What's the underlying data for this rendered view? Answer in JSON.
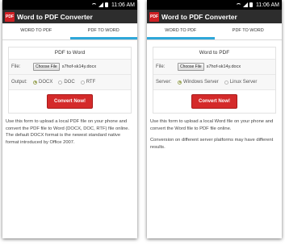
{
  "status": {
    "time": "11:06 AM"
  },
  "app": {
    "title": "Word to PDF Converter",
    "icon_text": "PDF"
  },
  "tabs": [
    "WORD TO PDF",
    "PDF TO WORD"
  ],
  "left": {
    "active_tab": 1,
    "card_title": "PDF to Word",
    "file_label": "File:",
    "choose_button": "Choose File",
    "file_name": "s7hof-sk14y.docx",
    "output_label": "Output:",
    "options": [
      "DOCX",
      "DOC",
      "RTF"
    ],
    "selected": "DOCX",
    "convert": "Convert Now!",
    "description": "Use this form to upload a local PDF file on your phone and convert the PDF file to Word (DOCX, DOC, RTF) file online. The default DOCX format is the newest standard native format introduced by Office 2007."
  },
  "right": {
    "active_tab": 0,
    "card_title": "Word to PDF",
    "file_label": "File:",
    "choose_button": "Choose File",
    "file_name": "s7hof-sk14y.docx",
    "server_label": "Server:",
    "options": [
      "Windows Server",
      "Linux Server"
    ],
    "selected": "Windows Server",
    "convert": "Convert Now!",
    "description_1": "Use this form to upload a local Word file on your phone and convert the Word file to PDF file online.",
    "description_2": "Conversion on different server platforms may have different results."
  }
}
